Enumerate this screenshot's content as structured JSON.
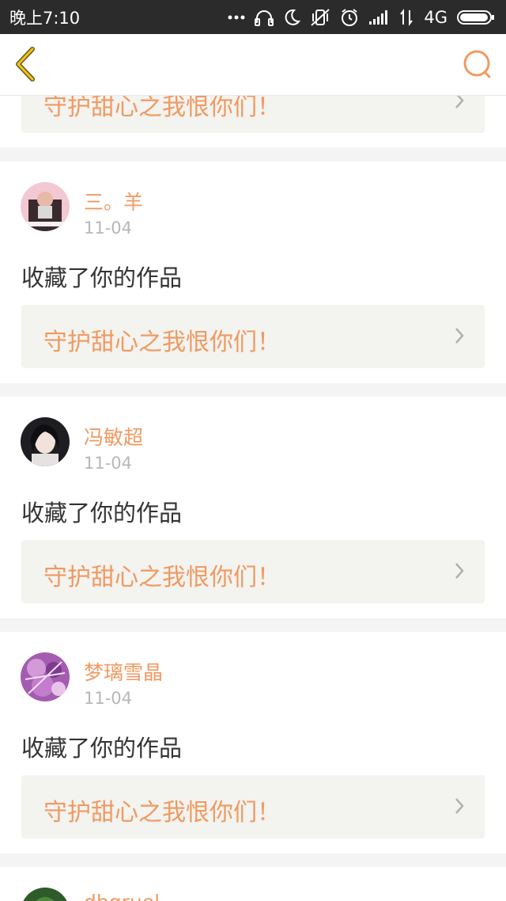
{
  "status_bar": {
    "time": "晚上7:10",
    "network": "4G",
    "icons": [
      "more-dots-icon",
      "headphones-icon",
      "moon-icon",
      "vibrate-off-icon",
      "alarm-icon",
      "signal-icon",
      "data-arrows-icon",
      "battery-icon"
    ]
  },
  "header": {
    "back_icon": "chevron-left-icon",
    "search_icon": "search-icon",
    "accent_color": "#ef9a62",
    "back_color": "#f0c419"
  },
  "feed": {
    "partial_top": {
      "work_title": "守护甜心之我恨你们！"
    },
    "items": [
      {
        "user": "三。羊",
        "date": "11-04",
        "action": "收藏了你的作品",
        "work_title": "守护甜心之我恨你们！",
        "avatar": "avatar-photo"
      },
      {
        "user": "冯敏超",
        "date": "11-04",
        "action": "收藏了你的作品",
        "work_title": "守护甜心之我恨你们！",
        "avatar": "avatar-photo"
      },
      {
        "user": "梦璃雪晶",
        "date": "11-04",
        "action": "收藏了你的作品",
        "work_title": "守护甜心之我恨你们！",
        "avatar": "avatar-photo"
      }
    ],
    "partial_bottom": {
      "user": "dbgruel"
    }
  },
  "colors": {
    "user_name": "#ef9a62",
    "date": "#b7b7b7",
    "link_bg": "#f3f3ef",
    "page_bg": "#f4f4f4"
  }
}
